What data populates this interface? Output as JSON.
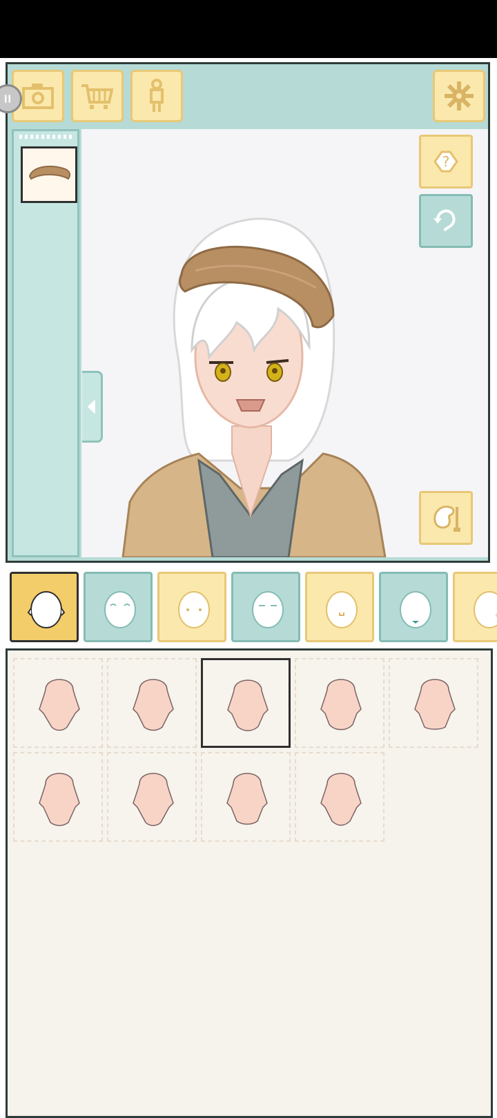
{
  "toolbar": {
    "buttons": [
      {
        "icon": "camera-icon"
      },
      {
        "icon": "shopping-cart-icon"
      },
      {
        "icon": "body-figure-icon"
      }
    ],
    "settings_icon": "gear-icon"
  },
  "side_buttons": [
    {
      "icon": "help-icon",
      "label": "?"
    },
    {
      "icon": "rotate-icon"
    },
    {
      "icon": "palette-icon"
    }
  ],
  "face_categories": [
    {
      "name": "face-shape",
      "active": true
    },
    {
      "name": "eyes"
    },
    {
      "name": "eyebrows-eyes-dots"
    },
    {
      "name": "closed-eyes"
    },
    {
      "name": "mouth"
    },
    {
      "name": "lower-face"
    },
    {
      "name": "blush"
    }
  ],
  "face_shape_grid": {
    "count": 9,
    "selected_index": 2
  },
  "colors": {
    "panel_teal": "#b6dbd6",
    "button_yellow": "#fbe8ad",
    "active_tab": "#f3cd6a",
    "skin": "#f8d4c6",
    "hat_brown": "#b88f62"
  }
}
